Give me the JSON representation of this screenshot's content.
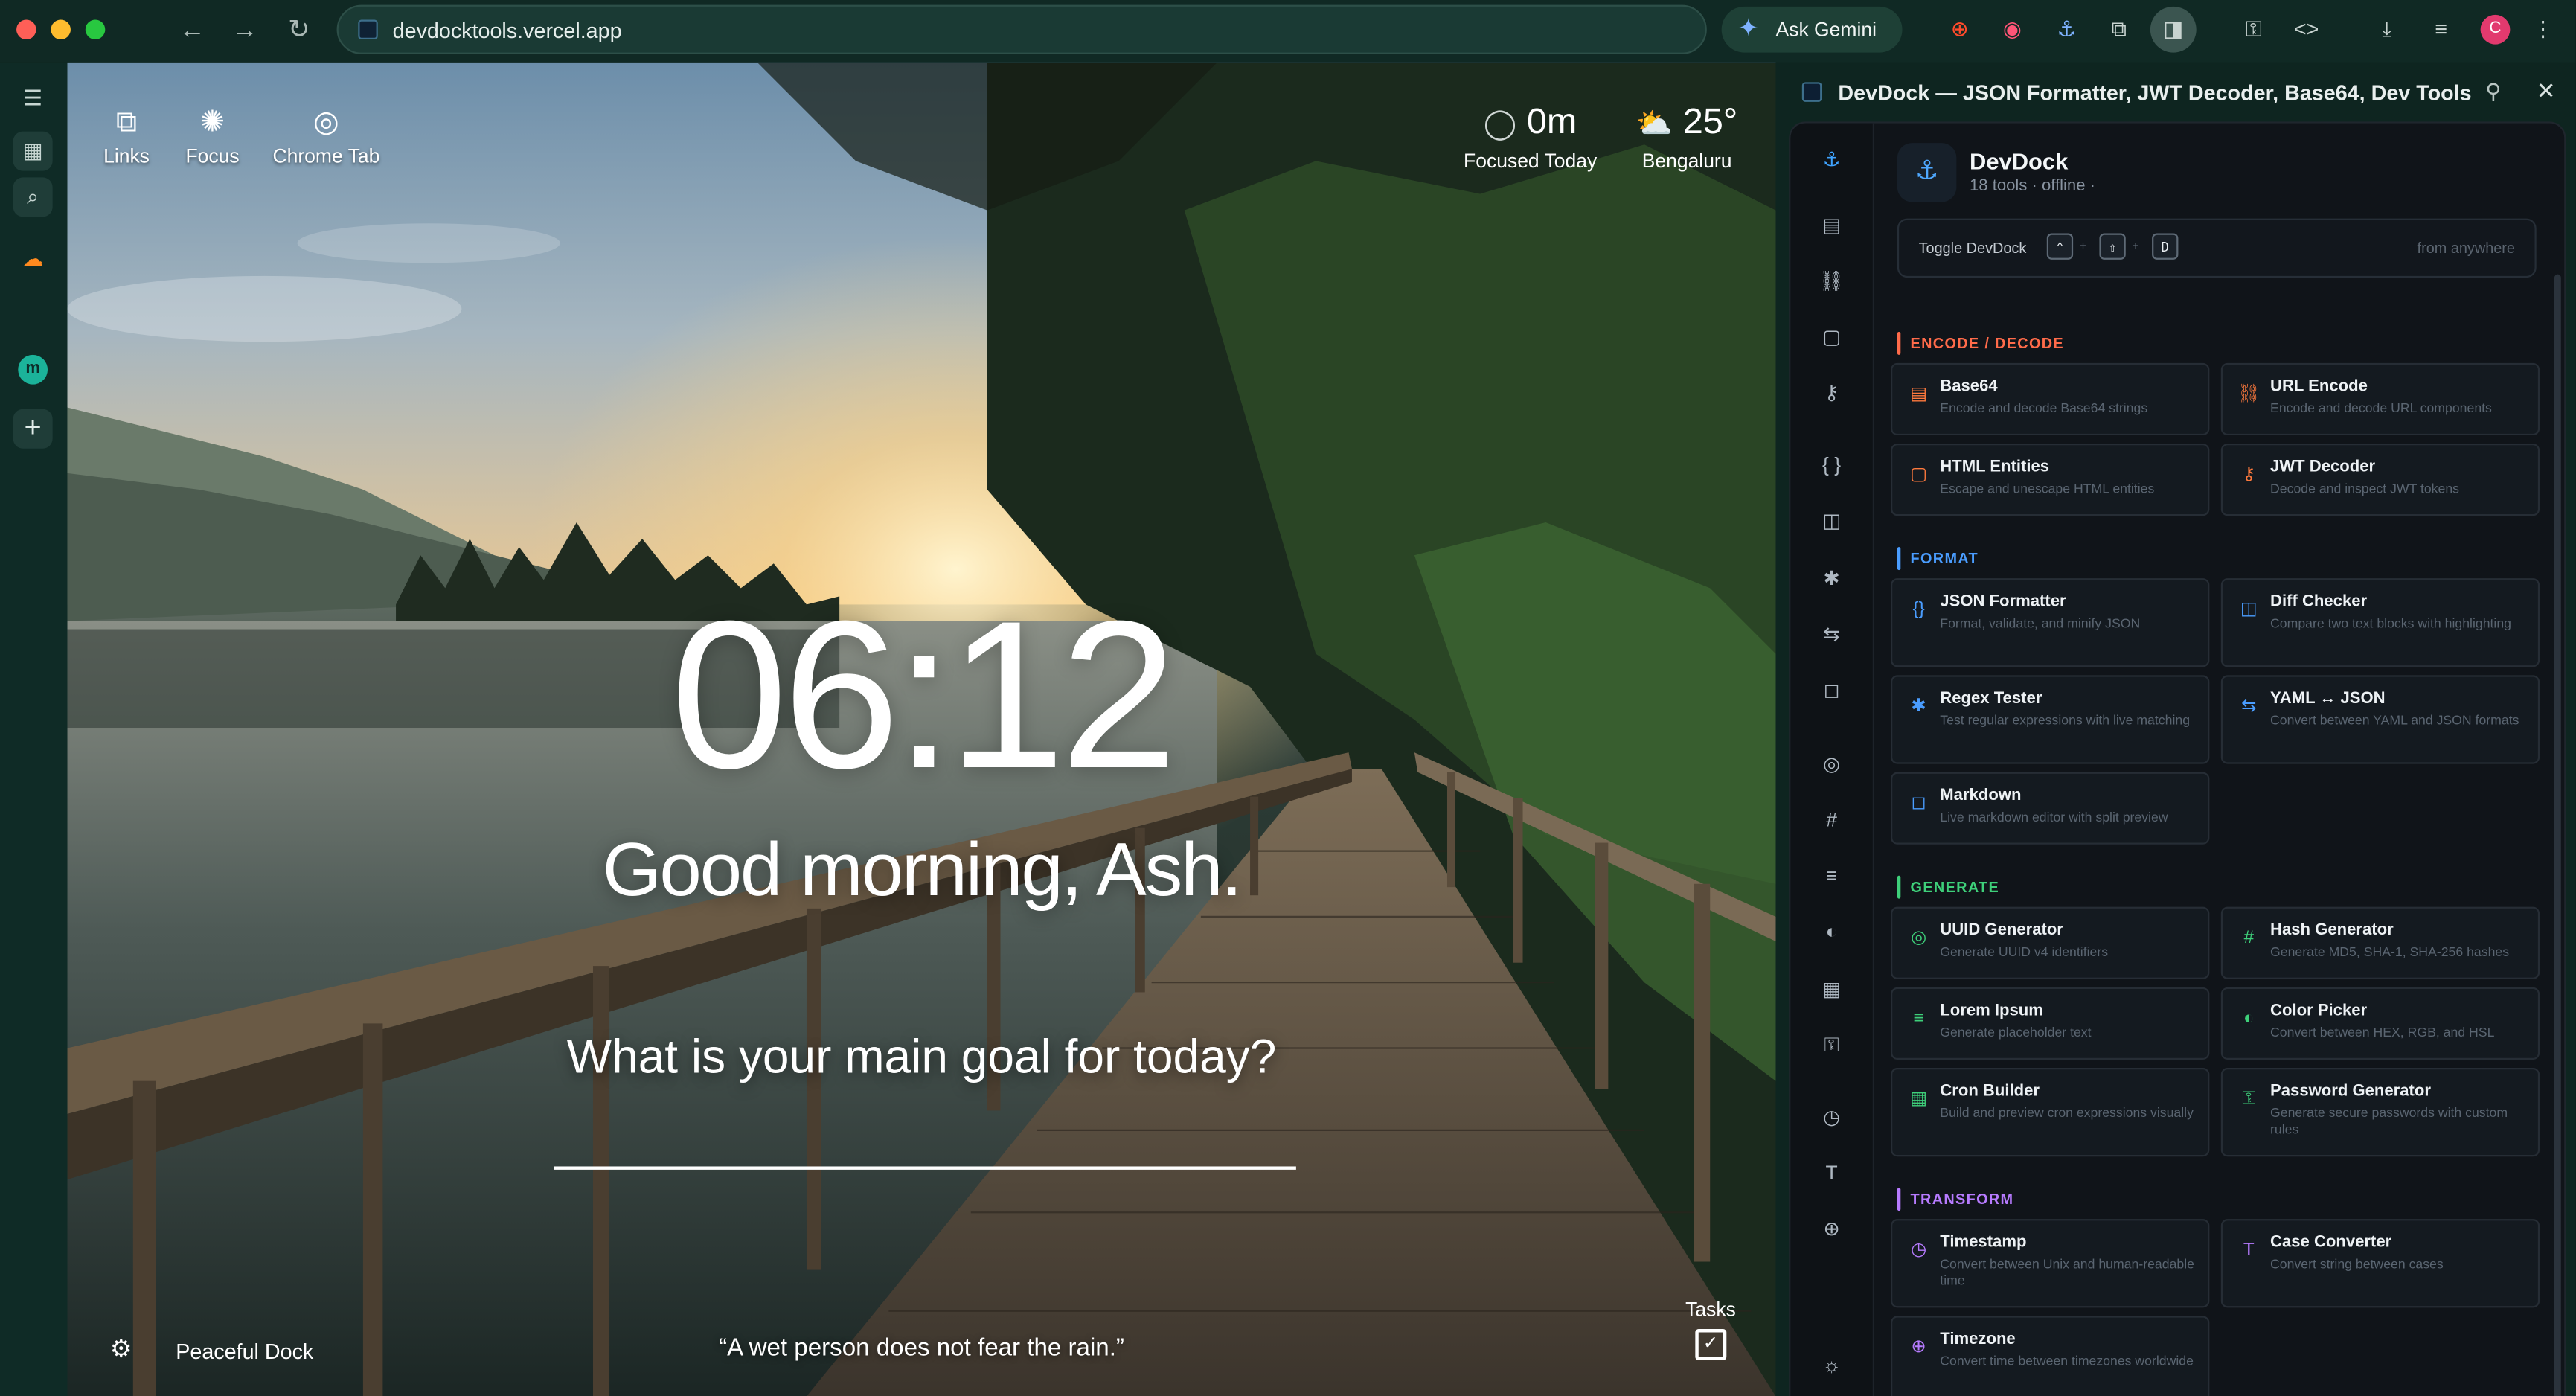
{
  "browser": {
    "url": "devdocktools.vercel.app",
    "ask_gemini": "Ask Gemini",
    "profile_initial": "C"
  },
  "newtab": {
    "links": [
      {
        "label": "Links",
        "icon": "external-link-icon"
      },
      {
        "label": "Focus",
        "icon": "brain-icon"
      },
      {
        "label": "Chrome Tab",
        "icon": "chrome-icon"
      }
    ],
    "focus_value": "0m",
    "focus_label": "Focused Today",
    "weather_value": "25°",
    "weather_city": "Bengaluru",
    "clock": "06:12",
    "greeting": "Good morning, Ash.",
    "question": "What is your main goal for today?",
    "goal_value": "",
    "quote": "“A wet person does not fear the rain.”",
    "dock_name": "Peaceful Dock",
    "tasks_label": "Tasks"
  },
  "sidepanel": {
    "title": "DevDock — JSON Formatter, JWT Decoder, Base64, Dev Tools",
    "app_name": "DevDock",
    "app_sub": "18 tools · offline ·",
    "toggle_label": "Toggle DevDock",
    "keys": [
      "⌃",
      "⇧",
      "D"
    ],
    "key_sep": "+",
    "toggle_hint": "from anywhere",
    "sections": [
      {
        "name": "ENCODE / DECODE",
        "color": "#ff6b4a"
      },
      {
        "name": "FORMAT",
        "color": "#4a9dff"
      },
      {
        "name": "GENERATE",
        "color": "#3ed07a"
      },
      {
        "name": "TRANSFORM",
        "color": "#b77bff"
      }
    ],
    "tools": [
      {
        "title": "Base64",
        "desc": "Encode and decode Base64 strings"
      },
      {
        "title": "URL Encode",
        "desc": "Encode and decode URL components"
      },
      {
        "title": "HTML Entities",
        "desc": "Escape and unescape HTML entities"
      },
      {
        "title": "JWT Decoder",
        "desc": "Decode and inspect JWT tokens"
      },
      {
        "title": "JSON Formatter",
        "desc": "Format, validate, and minify JSON"
      },
      {
        "title": "Diff Checker",
        "desc": "Compare two text blocks with highlighting"
      },
      {
        "title": "Regex Tester",
        "desc": "Test regular expressions with live matching"
      },
      {
        "title": "YAML ↔ JSON",
        "desc": "Convert between YAML and JSON formats"
      },
      {
        "title": "Markdown",
        "desc": "Live markdown editor with split preview"
      },
      {
        "title": "UUID Generator",
        "desc": "Generate UUID v4 identifiers"
      },
      {
        "title": "Hash Generator",
        "desc": "Generate MD5, SHA-1, SHA-256 hashes"
      },
      {
        "title": "Lorem Ipsum",
        "desc": "Generate placeholder text"
      },
      {
        "title": "Color Picker",
        "desc": "Convert between HEX, RGB, and HSL"
      },
      {
        "title": "Cron Builder",
        "desc": "Build and preview cron expressions visually"
      },
      {
        "title": "Password Generator",
        "desc": "Generate secure passwords with custom rules"
      },
      {
        "title": "Timestamp",
        "desc": "Convert between Unix and human-readable time"
      },
      {
        "title": "Case Converter",
        "desc": "Convert string between cases"
      },
      {
        "title": "Timezone",
        "desc": "Convert time between timezones worldwide"
      }
    ]
  }
}
